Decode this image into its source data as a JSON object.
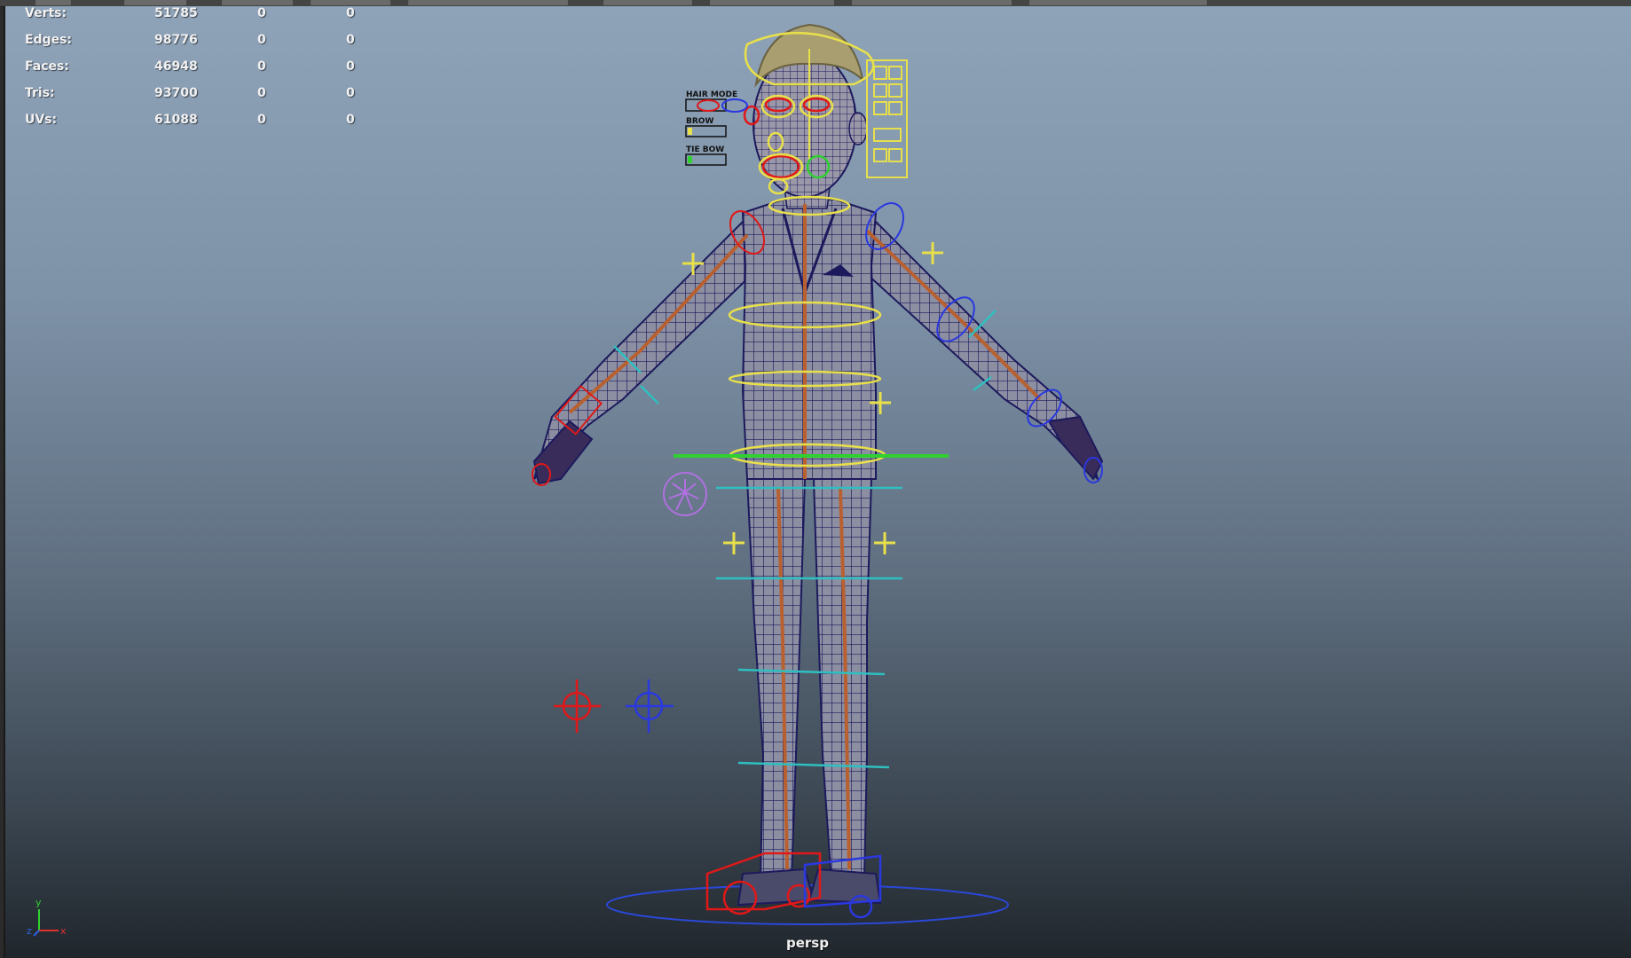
{
  "hud": {
    "rows": [
      {
        "label": "Verts:",
        "total": "51785",
        "selected": "0",
        "component": "0"
      },
      {
        "label": "Edges:",
        "total": "98776",
        "selected": "0",
        "component": "0"
      },
      {
        "label": "Faces:",
        "total": "46948",
        "selected": "0",
        "component": "0"
      },
      {
        "label": "Tris:",
        "total": "93700",
        "selected": "0",
        "component": "0"
      },
      {
        "label": "UVs:",
        "total": "61088",
        "selected": "0",
        "component": "0"
      }
    ]
  },
  "rig_panel": {
    "labels": [
      "HAIR MODE",
      "BROW",
      "TIE BOW"
    ]
  },
  "viewport": {
    "camera": "persp",
    "axis": {
      "y": "y",
      "x": "x",
      "z": "z"
    }
  },
  "colors": {
    "mesh_wire": "#1c1a5c",
    "control_yellow": "#e8e04a",
    "control_red": "#e01818",
    "control_blue": "#2a38e0",
    "joint_orange": "#b86030",
    "cyan": "#2ec0c0",
    "green": "#30d030",
    "purple": "#b070e0"
  }
}
